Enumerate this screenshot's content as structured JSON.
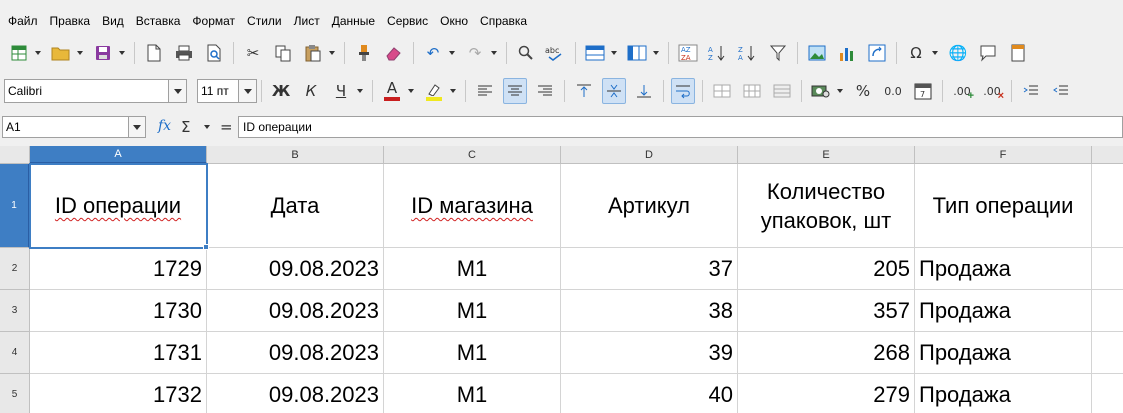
{
  "menu": [
    "Файл",
    "Правка",
    "Вид",
    "Вставка",
    "Формат",
    "Стили",
    "Лист",
    "Данные",
    "Сервис",
    "Окно",
    "Справка"
  ],
  "format_toolbar": {
    "font_name": "Calibri",
    "font_size": "11 пт",
    "bold": "Ж",
    "italic": "К",
    "underline": "Ч",
    "font_color_letter": "A",
    "percent": "%",
    "decimal": "0.0",
    "add_decimal": ".00",
    "remove_decimal": ".00"
  },
  "formula_bar": {
    "cell_ref": "A1",
    "fx": "fx",
    "sum": "Σ",
    "equals": "=",
    "content": "ID операции"
  },
  "columns": [
    "A",
    "B",
    "C",
    "D",
    "E",
    "F"
  ],
  "rows": [
    "1",
    "2",
    "3",
    "4",
    "5"
  ],
  "header_cells": [
    "ID операции",
    "Дата",
    "ID магазина",
    "Артикул",
    "Количество упаковок, шт",
    "Тип операции"
  ],
  "data_rows": [
    [
      "1729",
      "09.08.2023",
      "М1",
      "37",
      "205",
      "Продажа"
    ],
    [
      "1730",
      "09.08.2023",
      "М1",
      "38",
      "357",
      "Продажа"
    ],
    [
      "1731",
      "09.08.2023",
      "М1",
      "39",
      "268",
      "Продажа"
    ],
    [
      "1732",
      "09.08.2023",
      "М1",
      "40",
      "279",
      "Продажа"
    ]
  ],
  "selected_cell": "A1",
  "colors": {
    "selection": "#3e7ec4",
    "header_bg": "#e8e8e8",
    "spellcheck": "#d02020",
    "font_color_bar": "#c81e1e",
    "highlight_bar": "#f0e81e"
  }
}
